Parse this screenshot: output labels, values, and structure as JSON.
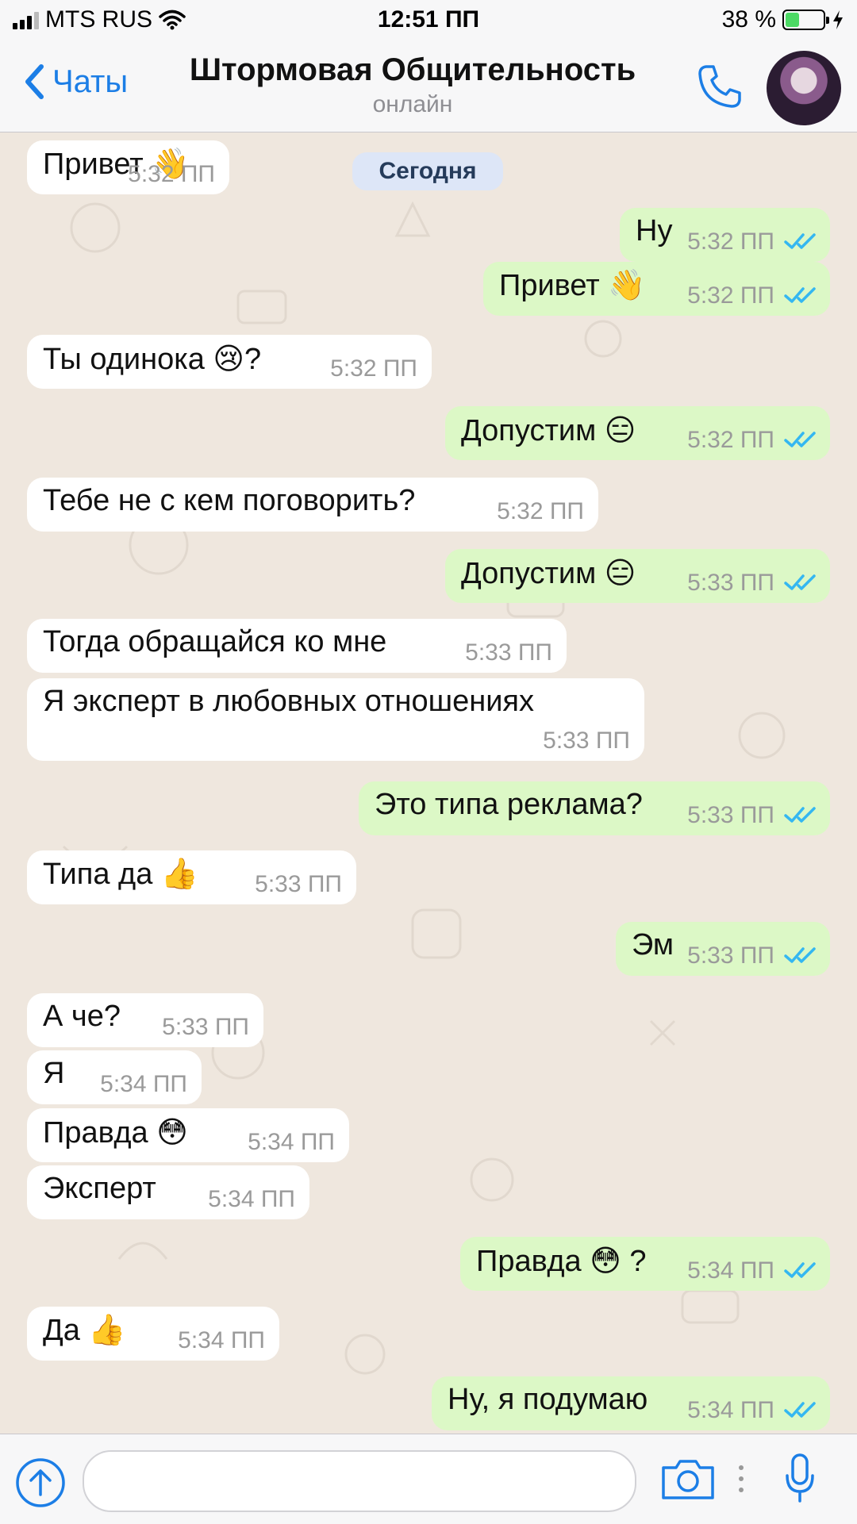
{
  "status_bar": {
    "carrier": "MTS RUS",
    "time": "12:51 ПП",
    "battery": "38 %",
    "battery_level": 0.38
  },
  "header": {
    "back_label": "Чаты",
    "title": "Штормовая Общительность",
    "subtitle": "онлайн"
  },
  "date_badge": "Сегодня",
  "messages": [
    {
      "dir": "in",
      "text": "Привет 👋",
      "time": "5:32 ПП"
    },
    {
      "dir": "out",
      "text": "Ну",
      "time": "5:32 ПП"
    },
    {
      "dir": "out",
      "text": "Привет 👋",
      "time": "5:32 ПП"
    },
    {
      "dir": "in",
      "text": "Ты одинока 😢?",
      "time": "5:32 ПП"
    },
    {
      "dir": "out",
      "text": "Допустим 😑",
      "time": "5:32 ПП"
    },
    {
      "dir": "in",
      "text": "Тебе не с кем поговорить?",
      "time": "5:32 ПП"
    },
    {
      "dir": "out",
      "text": "Допустим 😑",
      "time": "5:33 ПП"
    },
    {
      "dir": "in",
      "text": "Тогда обращайся ко мне",
      "time": "5:33 ПП"
    },
    {
      "dir": "in",
      "text": "Я эксперт в любовных отношениях",
      "time": "5:33 ПП"
    },
    {
      "dir": "out",
      "text": "Это типа реклама?",
      "time": "5:33 ПП"
    },
    {
      "dir": "in",
      "text": "Типа да 👍",
      "time": "5:33 ПП"
    },
    {
      "dir": "out",
      "text": "Эм",
      "time": "5:33 ПП"
    },
    {
      "dir": "in",
      "text": "А че?",
      "time": "5:33 ПП"
    },
    {
      "dir": "in",
      "text": "Я",
      "time": "5:34 ПП"
    },
    {
      "dir": "in",
      "text": "Правда 😳",
      "time": "5:34 ПП"
    },
    {
      "dir": "in",
      "text": "Эксперт",
      "time": "5:34 ПП"
    },
    {
      "dir": "out",
      "text": "Правда 😳 ?",
      "time": "5:34 ПП"
    },
    {
      "dir": "in",
      "text": "Да 👍",
      "time": "5:34 ПП"
    },
    {
      "dir": "out",
      "text": "Ну, я подумаю",
      "time": "5:34 ПП"
    }
  ],
  "input": {
    "placeholder": ""
  },
  "colors": {
    "accent": "#1c7ee6",
    "incoming": "#ffffff",
    "outgoing": "#dcf8c6",
    "background": "#efe7de",
    "ticks": "#34b7f1"
  }
}
